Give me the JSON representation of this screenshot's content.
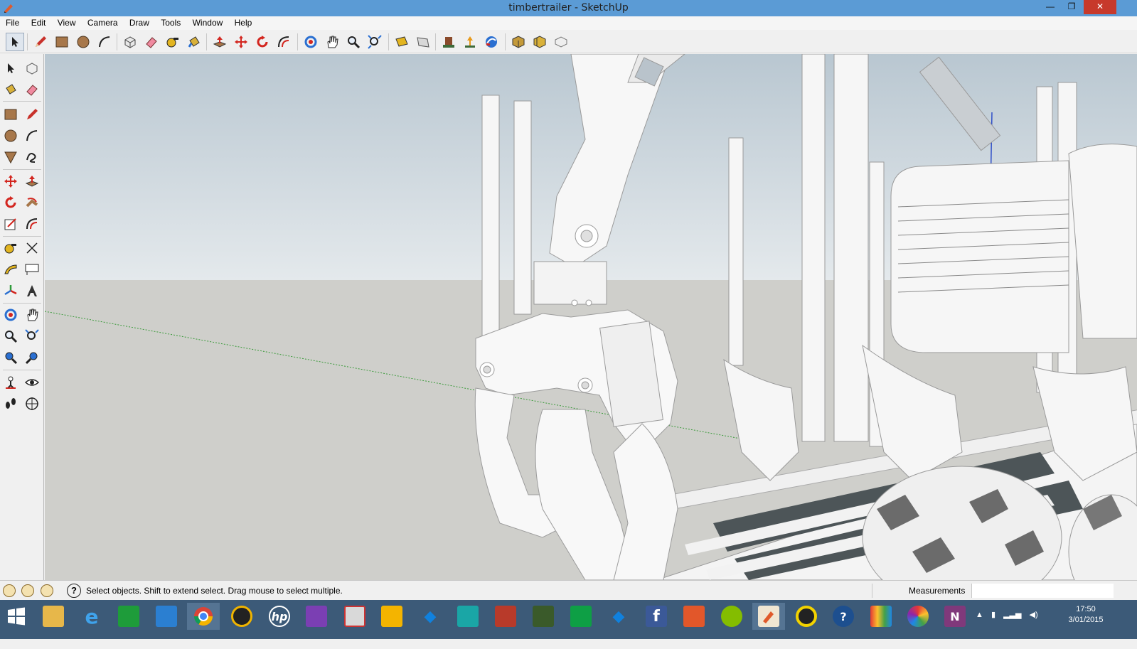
{
  "window": {
    "title": "timbertrailer - SketchUp",
    "min_glyph": "—",
    "max_glyph": "❐",
    "close_glyph": "✕"
  },
  "menu": {
    "items": [
      "File",
      "Edit",
      "View",
      "Camera",
      "Draw",
      "Tools",
      "Window",
      "Help"
    ]
  },
  "toolbar": {
    "icons": [
      "select-icon",
      "pencil-icon",
      "rectangle-icon",
      "circle-icon",
      "arc-icon",
      "make-component-icon",
      "eraser-icon",
      "tape-measure-icon",
      "paint-bucket-icon",
      "push-pull-icon",
      "move-icon",
      "rotate-icon",
      "offset-icon",
      "orbit-icon",
      "pan-icon",
      "zoom-icon",
      "zoom-extents-icon",
      "previous-view-icon",
      "next-view-icon",
      "get-models-icon",
      "share-model-icon",
      "extension-warehouse-icon",
      "components-icon",
      "styles-icon",
      "send-to-layout-icon"
    ]
  },
  "left_toolbar": {
    "icons": [
      "select-icon",
      "make-component-icon",
      "paint-bucket-icon",
      "eraser-icon",
      "rectangle-icon",
      "line-icon",
      "circle-icon",
      "arc-icon",
      "polygon-icon",
      "freehand-icon",
      "move-icon",
      "push-pull-icon",
      "rotate-icon",
      "follow-me-icon",
      "scale-icon",
      "offset-icon",
      "tape-measure-icon",
      "dimensions-icon",
      "protractor-icon",
      "text-icon",
      "axes-icon",
      "3d-text-icon",
      "orbit-icon",
      "pan-icon",
      "zoom-icon",
      "zoom-window-icon",
      "previous-icon",
      "zoom-extents-icon",
      "position-camera-icon",
      "look-around-icon",
      "walk-icon",
      "section-plane-icon"
    ]
  },
  "status": {
    "hint": "Select objects. Shift to extend select. Drag mouse to select multiple.",
    "help_glyph": "?",
    "measurements_label": "Measurements"
  },
  "taskbar": {
    "apps": [
      "start",
      "file-explorer",
      "internet-explorer",
      "store",
      "app-rocket",
      "chrome",
      "media-player",
      "hp",
      "app-purple",
      "app-games",
      "slides",
      "dropbox",
      "3ds-max",
      "farming-simulator",
      "farming-game",
      "calculator-sheet",
      "dropbox-2",
      "facebook",
      "audio-app",
      "spotify",
      "sketchup",
      "circle-app",
      "help",
      "studio",
      "picasa",
      "onenote"
    ],
    "clock_time": "17:50",
    "clock_date": "3/01/2015"
  },
  "colors": {
    "titlebar": "#5b9bd5",
    "close_button": "#c7392b",
    "sky": "#c9d4dc",
    "ground": "#cfcfcb",
    "taskbar": "#3c5a78"
  }
}
